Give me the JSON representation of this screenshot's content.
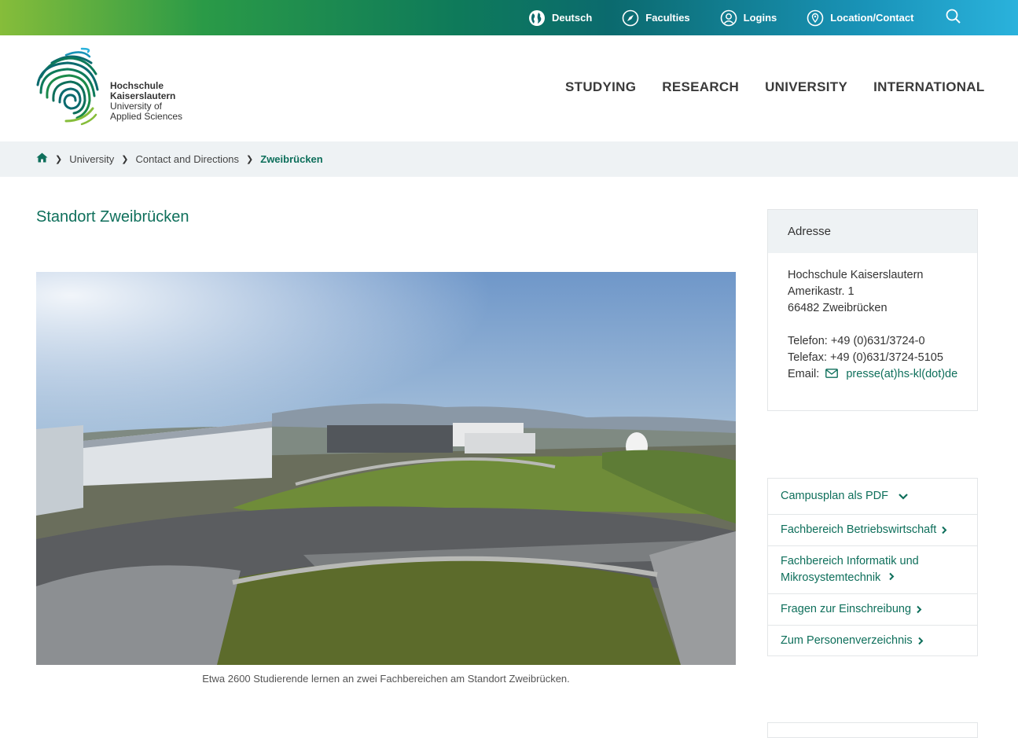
{
  "topnav": {
    "items": [
      {
        "label": "Deutsch",
        "icon": "globe-icon"
      },
      {
        "label": "Faculties",
        "icon": "compass-icon"
      },
      {
        "label": "Logins",
        "icon": "user-icon"
      },
      {
        "label": "Location/Contact",
        "icon": "location-pin-icon"
      }
    ],
    "search_icon": "search-icon"
  },
  "logo": {
    "line1": "Hochschule",
    "line2": "Kaiserslautern",
    "line3": "University of",
    "line4": "Applied Sciences"
  },
  "mainnav": [
    "STUDYING",
    "RESEARCH",
    "UNIVERSITY",
    "INTERNATIONAL"
  ],
  "breadcrumb": {
    "home_icon": "home-icon",
    "items": [
      "University",
      "Contact and Directions"
    ],
    "current": "Zweibrücken"
  },
  "main": {
    "title": "Standort Zweibrücken",
    "caption": "Etwa 2600 Studierende lernen an zwei Fachbereichen am Standort Zweibrücken."
  },
  "address": {
    "heading": "Adresse",
    "lines": [
      "Hochschule Kaiserslautern",
      "Amerikastr. 1",
      "66482 Zweibrücken"
    ],
    "phone": "Telefon: +49 (0)631/3724-0",
    "fax": "Telefax: +49 (0)631/3724-5105",
    "email_label": "Email:",
    "email_link": "presse(at)hs-kl(dot)de"
  },
  "links": [
    {
      "label": "Campusplan als PDF",
      "chevron": "chevron-down-icon"
    },
    {
      "label": "Fachbereich Betriebswirtschaft",
      "chevron": "chevron-right-icon"
    },
    {
      "label": "Fachbereich Informatik und Mikrosystemtechnik",
      "chevron": "chevron-right-icon"
    },
    {
      "label": "Fragen zur Einschreibung",
      "chevron": "chevron-right-icon"
    },
    {
      "label": "Zum Personenverzeichnis",
      "chevron": "chevron-right-icon"
    }
  ],
  "colors": {
    "brand_green": "#0e6f5b",
    "bar_start": "#86bd3a",
    "bar_end": "#2ab2dc",
    "crumb_bg": "#eef2f4"
  }
}
